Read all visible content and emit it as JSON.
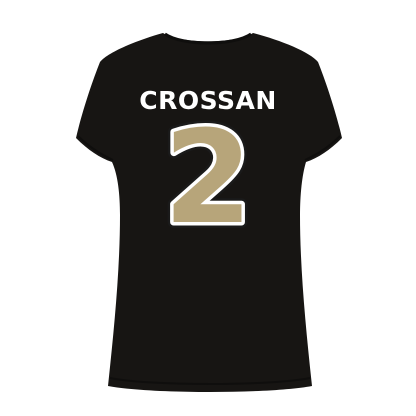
{
  "product": {
    "player_name": "CROSSAN",
    "jersey_number": "2"
  },
  "colors": {
    "background": "#ffffff",
    "shirt": "#171513",
    "shirt_shadow": "#0f0e0d",
    "name_text": "#ffffff",
    "number_fill": "#b7a57a",
    "number_inner_outline": "#ffffff",
    "number_outer_outline": "#1a1a1a"
  }
}
